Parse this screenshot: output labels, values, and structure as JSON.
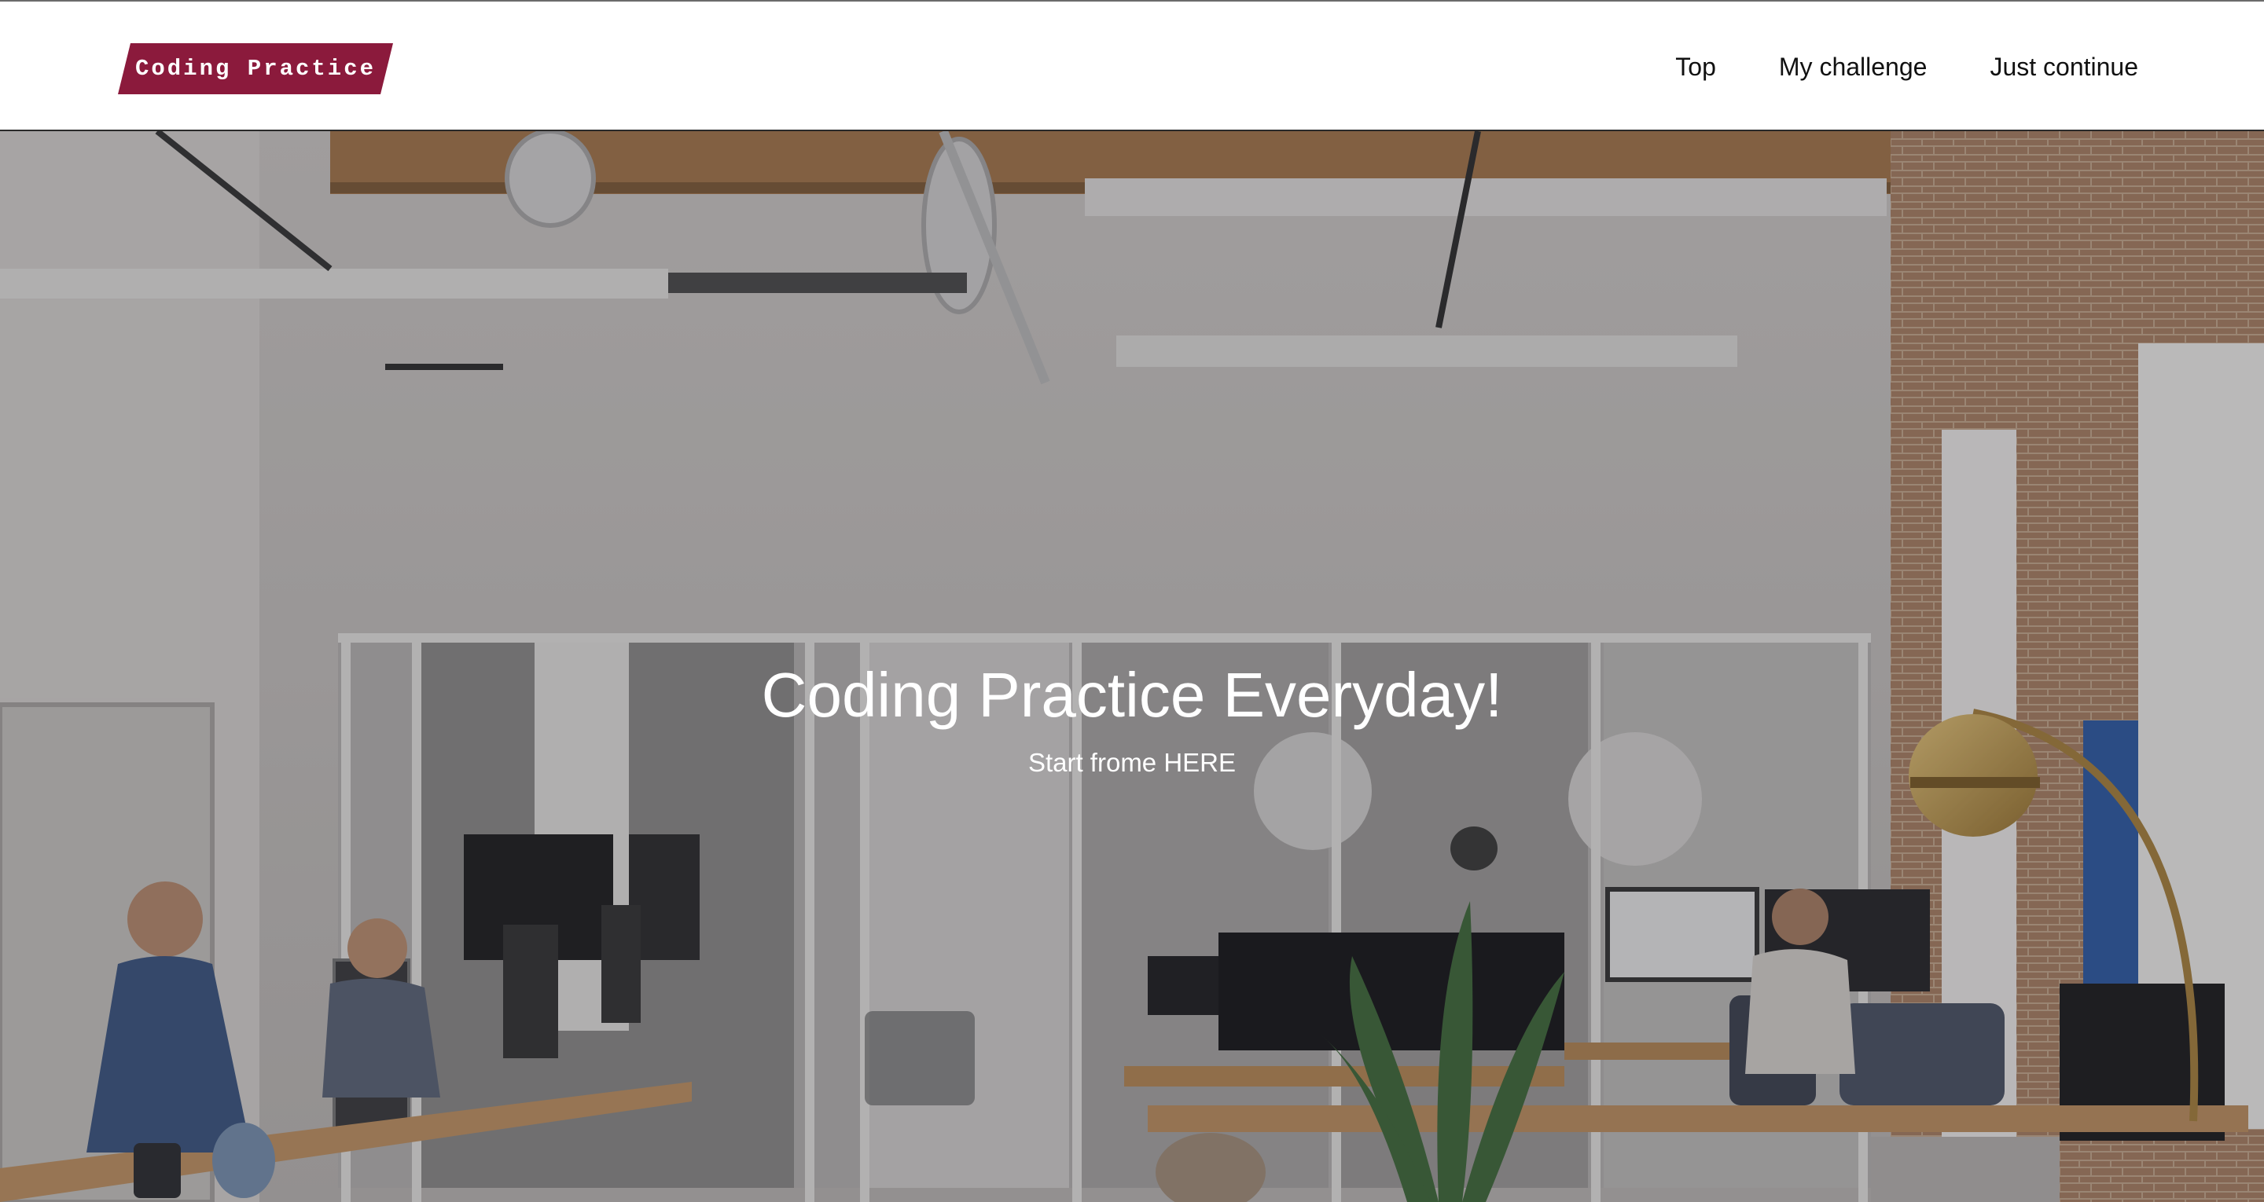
{
  "header": {
    "logo_text": "Coding Practice",
    "logo_color": "#8b1a3c",
    "nav": [
      {
        "label": "Top"
      },
      {
        "label": "My challenge"
      },
      {
        "label": "Just continue"
      }
    ]
  },
  "hero": {
    "title": "Coding Practice Everyday!",
    "subtitle": "Start frome HERE"
  }
}
